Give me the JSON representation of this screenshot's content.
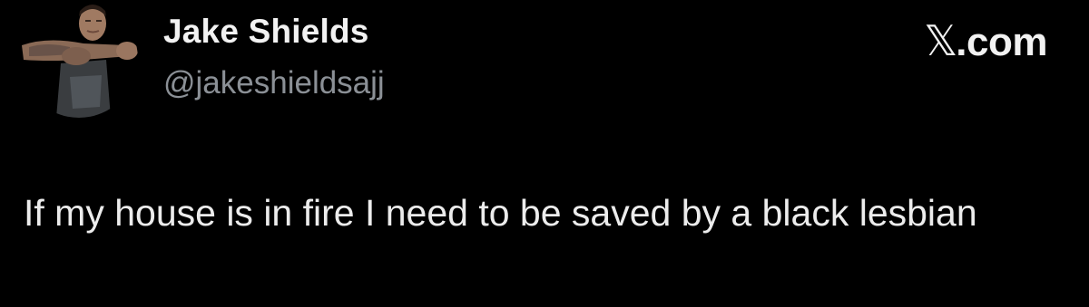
{
  "author": {
    "display_name": "Jake Shields",
    "handle": "@jakeshieldsajj",
    "avatar_icon": "profile-photo"
  },
  "brand": {
    "mark": "𝕏",
    "suffix": ".com"
  },
  "tweet": {
    "text": "If my house is in fire I need to be saved by a black lesbian"
  },
  "colors": {
    "background": "#000000",
    "name_text": "#f2f2f2",
    "handle_text": "#8b9096",
    "body_text": "#ececec"
  }
}
